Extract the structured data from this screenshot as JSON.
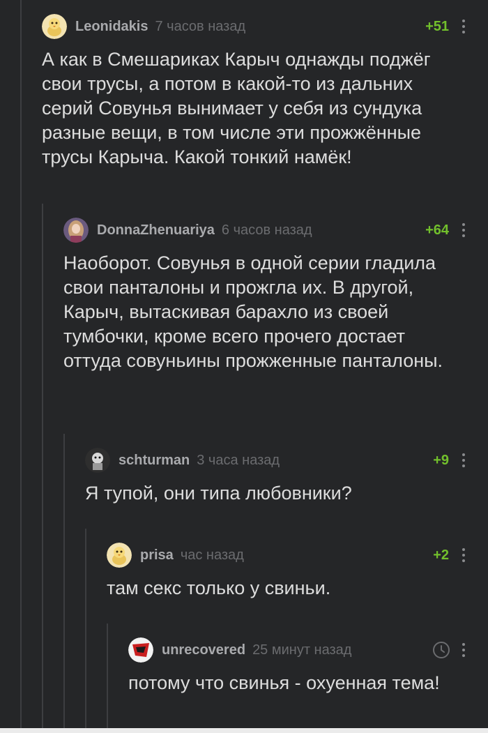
{
  "comments": [
    {
      "username": "Leonidakis",
      "time": "7 часов назад",
      "rating": "+51",
      "avatar_icon": "chick-avatar",
      "text": "А как в Смешариках Карыч однажды поджёг свои трусы, а потом в какой-то из дальних серий Совунья вынимает у себя из сундука разные вещи, в том числе эти прожжённые трусы Карыча. Какой тонкий намёк!"
    },
    {
      "username": "DonnaZhenuariya",
      "time": "6 часов назад",
      "rating": "+64",
      "avatar_icon": "woman-portrait-avatar",
      "text": "Наоборот. Совунья в одной серии гладила свои панталоны и прожгла их. В другой, Карыч, вытаскивая барахло из своей тумбочки, кроме всего прочего достает оттуда совуньины прожженные панталоны."
    },
    {
      "username": "schturman",
      "time": "3 часа назад",
      "rating": "+9",
      "avatar_icon": "dark-character-avatar",
      "text": "Я тупой, они типа любовники?"
    },
    {
      "username": "prisa",
      "time": "час назад",
      "rating": "+2",
      "avatar_icon": "chick-avatar",
      "text": "там секс только у свиньи."
    },
    {
      "username": "unrecovered",
      "time": "25 минут назад",
      "rating": "",
      "rating_icon": "clock-icon",
      "avatar_icon": "red-mask-avatar",
      "text": "потому что свинья - охуенная тема!"
    }
  ],
  "colors": {
    "background": "#252628",
    "text": "#dddddd",
    "username": "#a9aaad",
    "time": "#6b6c6f",
    "rating_positive": "#72c02c",
    "thread_line": "#3d3e41"
  }
}
